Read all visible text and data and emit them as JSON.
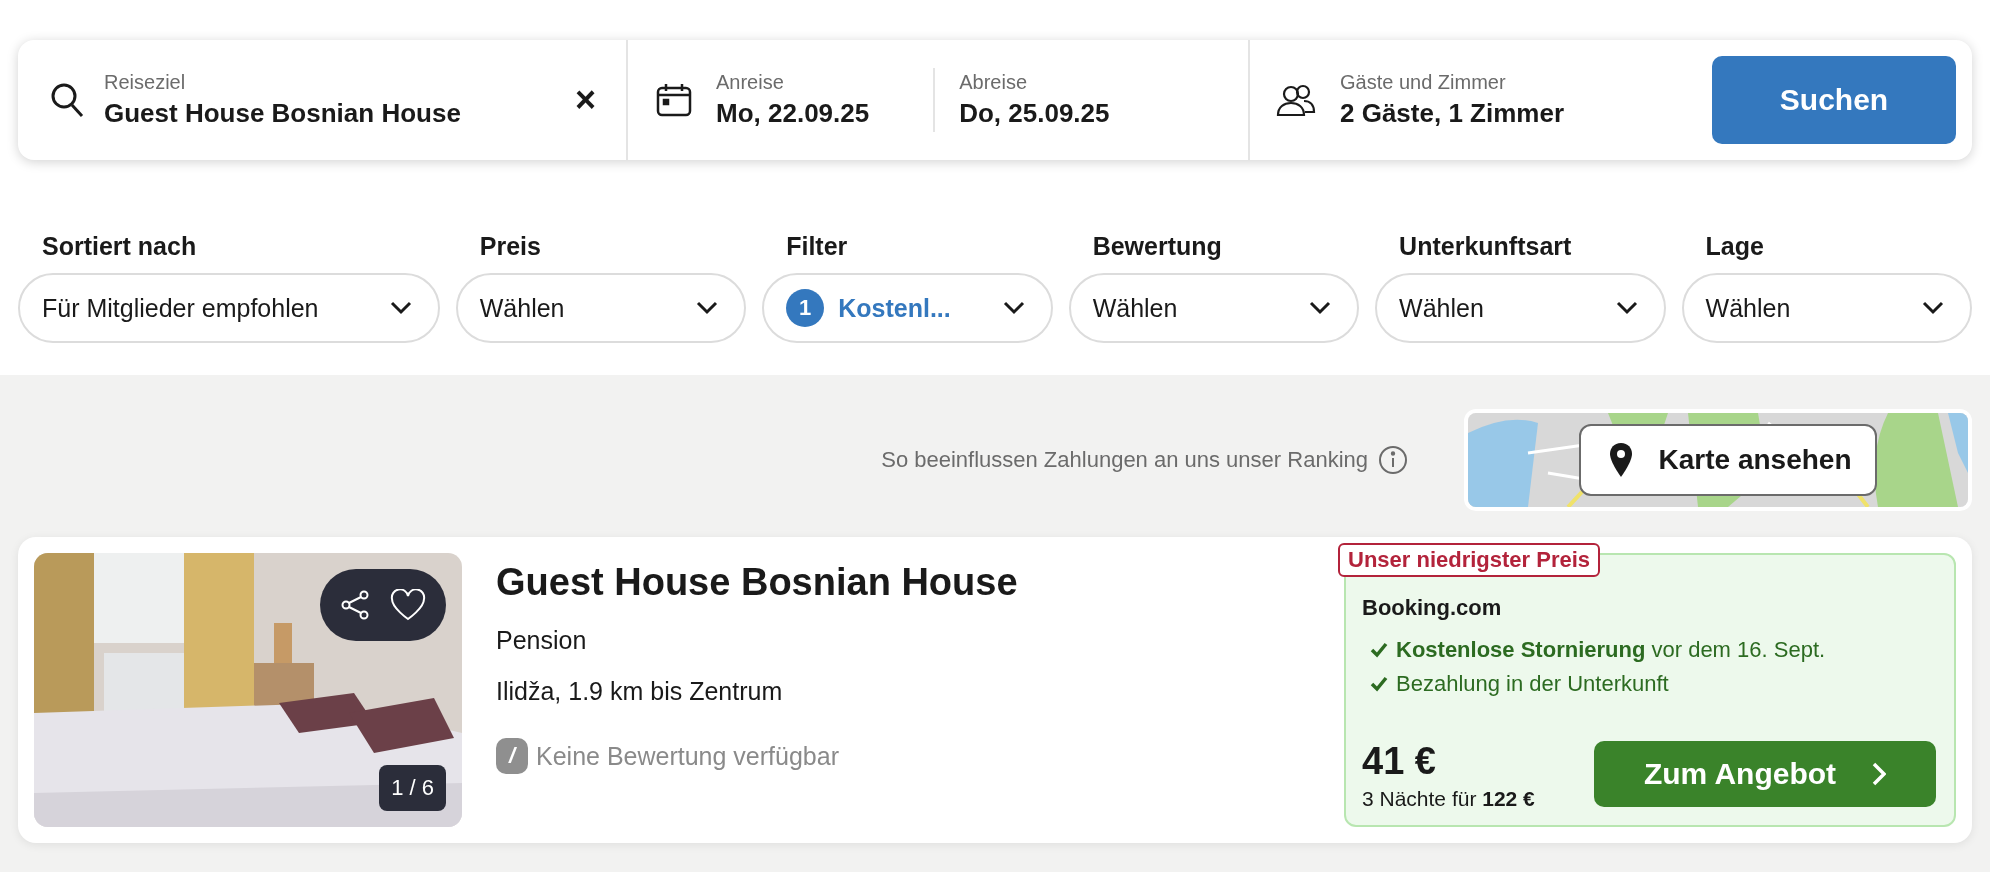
{
  "search_bar": {
    "destination": {
      "label": "Reiseziel",
      "value": "Guest House Bosnian House",
      "clear": "×"
    },
    "checkin": {
      "label": "Anreise",
      "value": "Mo, 22.09.25"
    },
    "checkout": {
      "label": "Abreise",
      "value": "Do, 25.09.25"
    },
    "guests": {
      "label": "Gäste und Zimmer",
      "value": "2 Gäste, 1 Zimmer"
    },
    "button": "Suchen"
  },
  "filters": [
    {
      "label": "Sortiert nach",
      "value": "Für Mitglieder empfohlen",
      "active": false
    },
    {
      "label": "Preis",
      "value": "Wählen",
      "active": false
    },
    {
      "label": "Filter",
      "value": "Kostenl...",
      "active": true,
      "badge": "1"
    },
    {
      "label": "Bewertung",
      "value": "Wählen",
      "active": false
    },
    {
      "label": "Unterkunftsart",
      "value": "Wählen",
      "active": false
    },
    {
      "label": "Lage",
      "value": "Wählen",
      "active": false
    }
  ],
  "ranking_note": "So beeinflussen Zahlungen an uns unser Ranking",
  "map_button": "Karte ansehen",
  "results": [
    {
      "photo": {
        "kind": "picture",
        "counter": "1 / 6"
      },
      "name": "Guest House Bosnian House",
      "type": "Pension",
      "location": "Ilidža, 1.9 km bis Zentrum",
      "rating_badge": "/",
      "rating": "Keine Bewertung verfügbar",
      "offer": {
        "tag": "Unser niedrigster Preis",
        "provider": "Booking.com",
        "features": [
          "**Kostenlose Stornierung** vor dem 16. Sept.",
          "Bezahlung in der Unterkunft"
        ],
        "price": "41 €",
        "total": "3 Nächte für **122 €**",
        "button": "Zum Angebot"
      }
    }
  ]
}
